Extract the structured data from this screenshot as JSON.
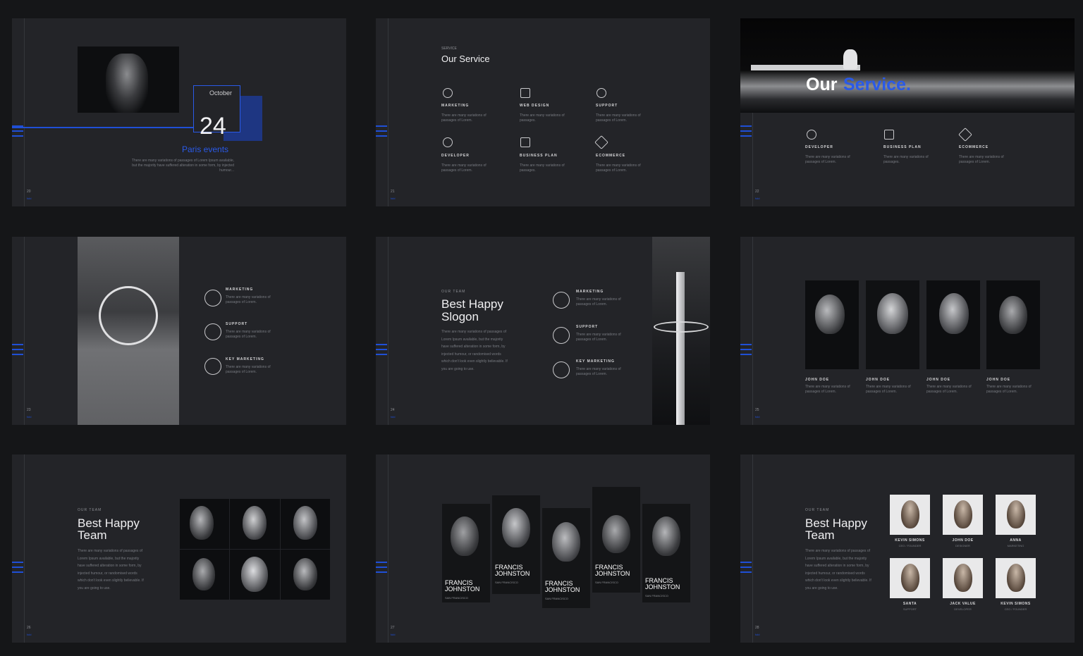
{
  "accent": "#1f4fd6",
  "background": "#151618",
  "slide_bg": "#232428",
  "slides": {
    "s1": {
      "page": "20",
      "brand": "fold",
      "month": "October",
      "day": "24",
      "title": "Paris events",
      "body": "There are many variations of passages of Lorem Ipsum available, but the majority have suffered alteration in some form, by injected humour..."
    },
    "s2": {
      "page": "21",
      "brand": "fold",
      "eyebrow": "SERVICE",
      "title": "Our Service",
      "items": [
        {
          "label": "MARKETING",
          "text": "There are many variations of passages of Lorem.",
          "icon": "clock-icon"
        },
        {
          "label": "WEB DESIGN",
          "text": "There are many variations of passages.",
          "icon": "monitor-icon"
        },
        {
          "label": "SUPPORT",
          "text": "There are many variations of passages of Lorem.",
          "icon": "lifebuoy-icon"
        },
        {
          "label": "DEVELOPER",
          "text": "There are many variations of passages of Lorem.",
          "icon": "gear-icon"
        },
        {
          "label": "BUSINESS PLAN",
          "text": "There are many variations of passages.",
          "icon": "briefcase-icon"
        },
        {
          "label": "ECOMMERCE",
          "text": "There are many variations of passages of Lorem.",
          "icon": "tag-icon"
        }
      ]
    },
    "s3": {
      "page": "22",
      "brand": "fold",
      "title_a": "Our",
      "title_b": "Service.",
      "items": [
        {
          "label": "DEVELOPER",
          "text": "There are many variations of passages of Lorem.",
          "icon": "gear-icon"
        },
        {
          "label": "BUSINESS PLAN",
          "text": "There are many variations of passages.",
          "icon": "briefcase-icon"
        },
        {
          "label": "ECOMMERCE",
          "text": "There are many variations of passages of Lorem.",
          "icon": "tag-icon"
        }
      ]
    },
    "s4": {
      "page": "23",
      "brand": "fold",
      "items": [
        {
          "label": "MARKETING",
          "text": "There are many variations of passages of Lorem.",
          "icon": "pencil-icon"
        },
        {
          "label": "SUPPORT",
          "text": "There are many variations of passages of Lorem.",
          "icon": "lifebuoy-icon"
        },
        {
          "label": "KEY MARKETING",
          "text": "There are many variations of passages of Lorem.",
          "icon": "lock-icon"
        }
      ]
    },
    "s5": {
      "page": "24",
      "brand": "fold",
      "eyebrow": "OUR TEAM",
      "title_1": "Best Happy",
      "title_2": "Slogon",
      "body": "There are many variations of passages of Lorem Ipsum available, but the majority have suffered alteration in some form, by injected humour, or randomised words which don't look even slightly believable. If you are going to use.",
      "items": [
        {
          "label": "MARKETING",
          "text": "There are many variations of passages of Lorem.",
          "icon": "pencil-icon"
        },
        {
          "label": "SUPPORT",
          "text": "There are many variations of passages of Lorem.",
          "icon": "lifebuoy-icon"
        },
        {
          "label": "KEY MARKETING",
          "text": "There are many variations of passages of Lorem.",
          "icon": "lock-icon"
        }
      ]
    },
    "s6": {
      "page": "25",
      "brand": "fold",
      "members": [
        {
          "name": "JOHN DOE",
          "text": "There are many variations of passages of Lorem."
        },
        {
          "name": "JOHN DOE",
          "text": "There are many variations of passages of Lorem."
        },
        {
          "name": "JOHN DOE",
          "text": "There are many variations of passages of Lorem."
        },
        {
          "name": "JOHN DOE",
          "text": "There are many variations of passages of Lorem."
        }
      ]
    },
    "s7": {
      "page": "26",
      "brand": "fold",
      "eyebrow": "OUR TEAM",
      "title_1": "Best Happy",
      "title_2": "Team",
      "body": "There are many variations of passages of Lorem Ipsum available, but the majority have suffered alteration in some form, by injected humour, or randomised words which don't look even slightly believable. If you are going to use."
    },
    "s8": {
      "page": "27",
      "brand": "fold",
      "cards": [
        {
          "name_1": "FRANCIS",
          "name_2": "JOHNSTON",
          "city": "SAN FRANCISCO"
        },
        {
          "name_1": "FRANCIS",
          "name_2": "JOHNSTON",
          "city": "SAN FRANCISCO"
        },
        {
          "name_1": "FRANCIS",
          "name_2": "JOHNSTON",
          "city": "SAN FRANCISCO"
        },
        {
          "name_1": "FRANCIS",
          "name_2": "JOHNSTON",
          "city": "SAN FRANCISCO"
        },
        {
          "name_1": "FRANCIS",
          "name_2": "JOHNSTON",
          "city": "SAN FRANCISCO"
        }
      ]
    },
    "s9": {
      "page": "28",
      "brand": "fold",
      "eyebrow": "OUR TEAM",
      "title_1": "Best Happy",
      "title_2": "Team",
      "body": "There are many variations of passages of Lorem Ipsum available, but the majority have suffered alteration in some form, by injected humour, or randomised words which don't look even slightly believable. If you are going to use.",
      "people": [
        {
          "name": "KEVIN SIMONS",
          "role": "CEO / FOUNDER"
        },
        {
          "name": "JOHN DOE",
          "role": "DESIGNER"
        },
        {
          "name": "ANNA",
          "role": "MARKETING"
        },
        {
          "name": "SANTA",
          "role": "SUPPORT"
        },
        {
          "name": "JACK VALUE",
          "role": "DEVELOPER"
        },
        {
          "name": "KEVIN SIMONS",
          "role": "CEO / FOUNDER"
        }
      ]
    }
  }
}
